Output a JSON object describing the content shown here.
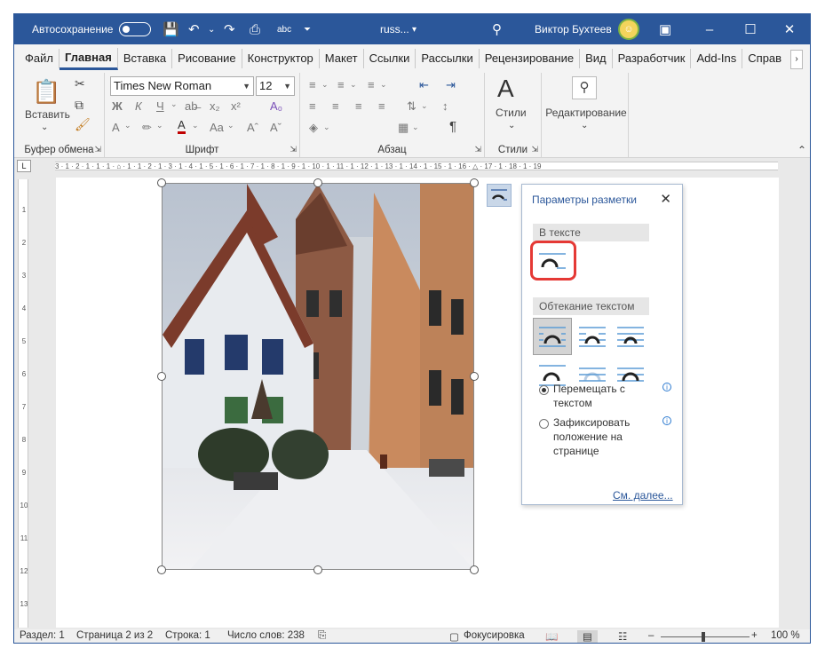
{
  "titlebar": {
    "autosave_label": "Автосохранение",
    "doc_name": "russ...",
    "user_name": "Виктор Бухтеев",
    "accent": "#2b579a"
  },
  "tabs": [
    "Файл",
    "Главная",
    "Вставка",
    "Рисование",
    "Конструктор",
    "Макет",
    "Ссылки",
    "Рассылки",
    "Рецензирование",
    "Вид",
    "Разработчик",
    "Add-Ins",
    "Справ"
  ],
  "active_tab": "Главная",
  "ribbon": {
    "clipboard": {
      "paste_label": "Вставить",
      "group_label": "Буфер обмена"
    },
    "font": {
      "font_name": "Times New Roman",
      "font_size": "12",
      "group_label": "Шрифт",
      "bold": "Ж",
      "italic": "К",
      "underline": "Ч",
      "size_label": "Aa"
    },
    "paragraph": {
      "group_label": "Абзац"
    },
    "styles": {
      "label": "Стили",
      "group_label": "Стили"
    },
    "editing": {
      "label": "Редактирование"
    }
  },
  "ruler": {
    "horizontal": "3 · 1 · 2 · 1 · 1 · 1 · ⌂ · 1 · 1 · 2 · 1 · 3 · 1 · 4 · 1 · 5 · 1 · 6 · 1 · 7 · 1 · 8 · 1 · 9 · 1 · 10 · 1 · 11 · 1 · 12 · 1 · 13 · 1 · 14 · 1 · 15 · 1 · 16 · △ · 17 · 1 · 18 · 1 · 19",
    "vertical": [
      "1",
      "2",
      "3",
      "4",
      "5",
      "6",
      "7",
      "8",
      "9",
      "10",
      "11",
      "12",
      "13"
    ]
  },
  "layout_panel": {
    "title": "Параметры разметки",
    "in_text_section": "В тексте",
    "wrap_section": "Обтекание текстом",
    "option_move": "Перемещать с текстом",
    "option_fix": "Зафиксировать положение на странице",
    "see_more": "См. далее..."
  },
  "statusbar": {
    "section": "Раздел: 1",
    "page": "Страница 2 из 2",
    "line": "Строка: 1",
    "words": "Число слов: 238",
    "focus": "Фокусировка",
    "zoom": "100 %"
  }
}
